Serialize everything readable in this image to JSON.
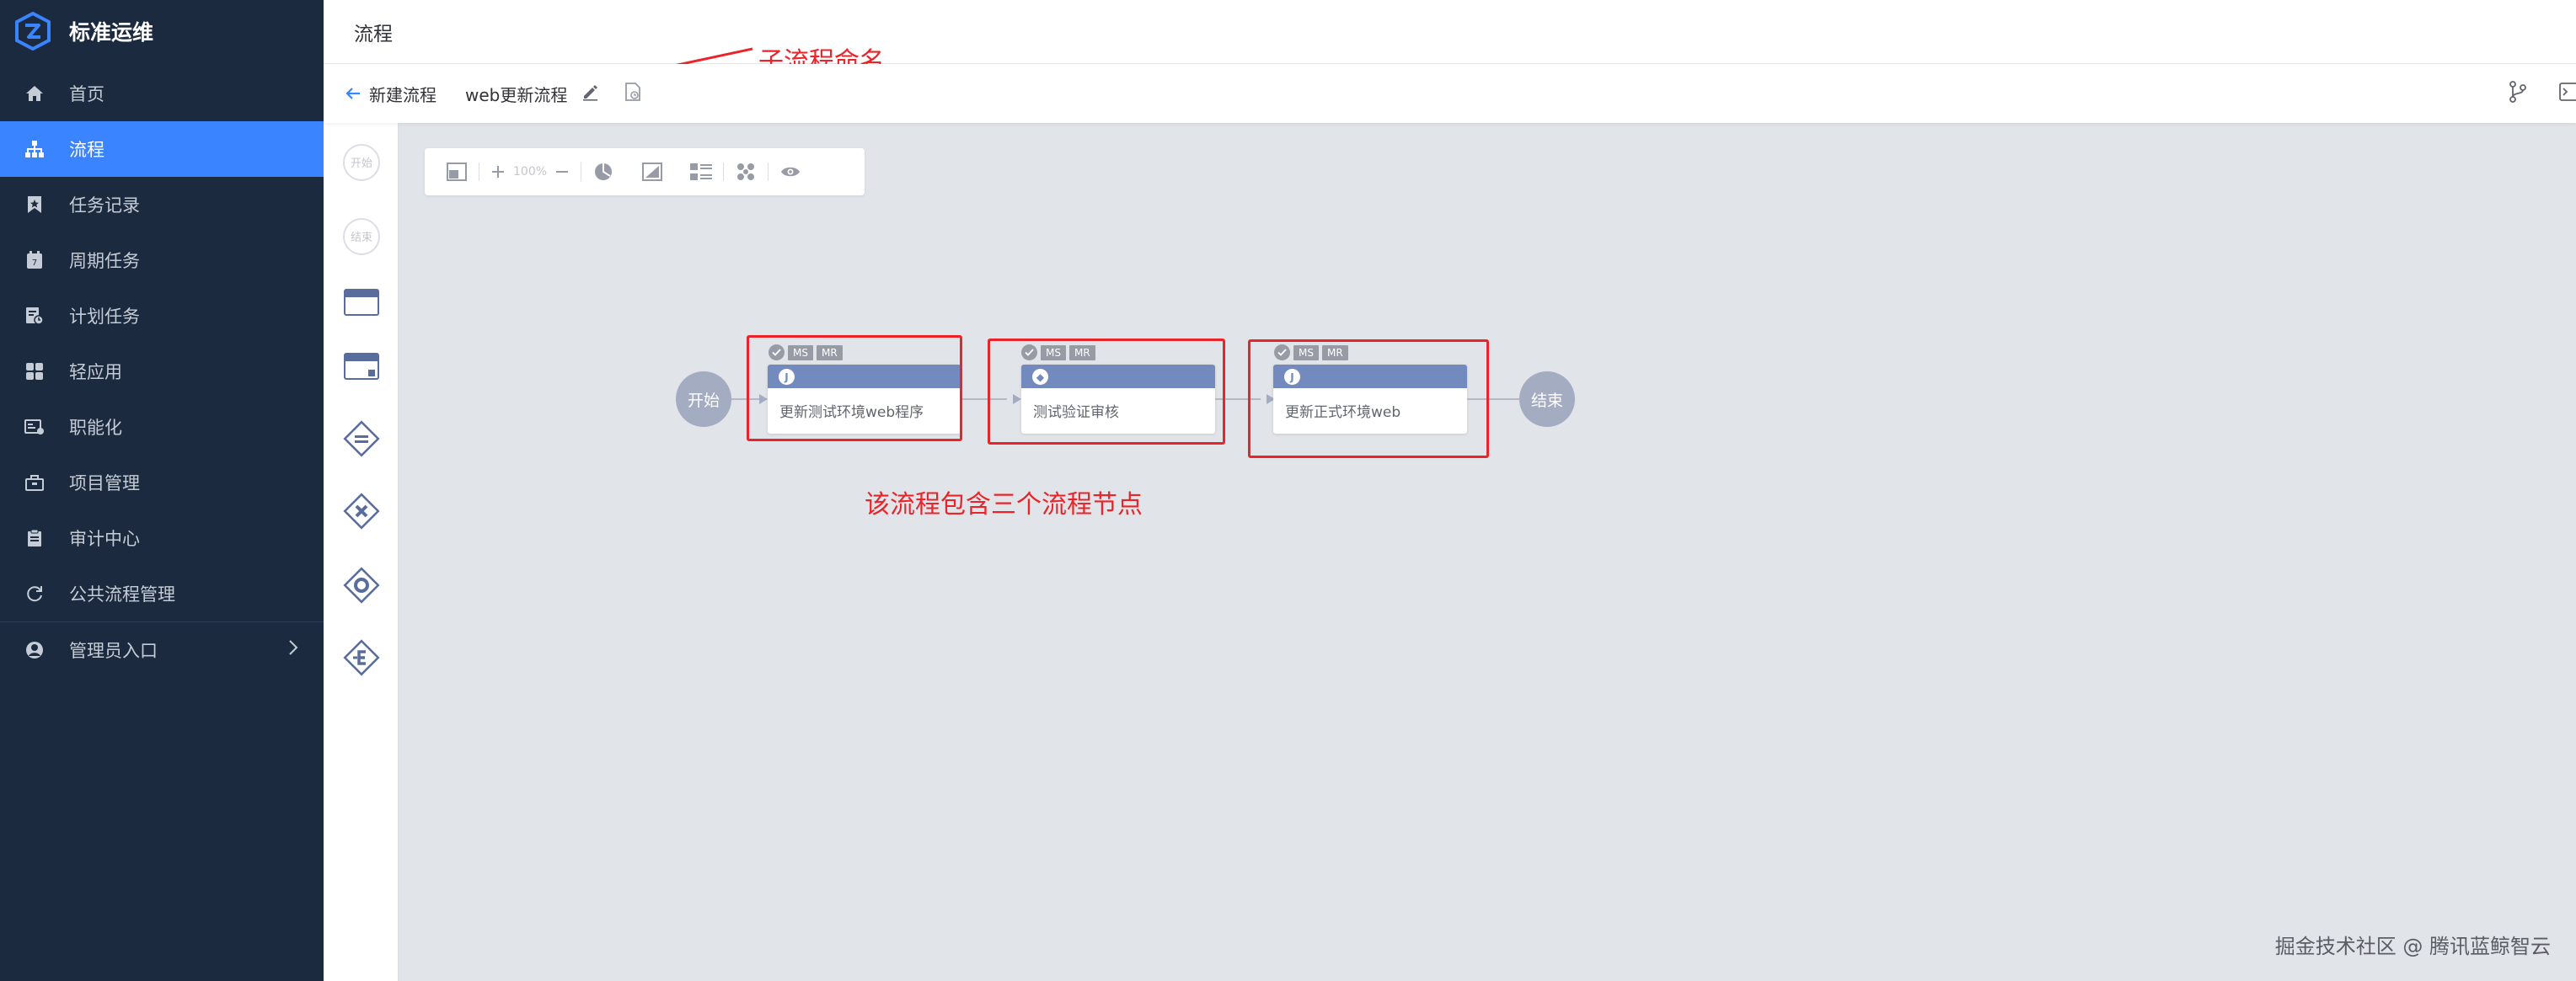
{
  "app": {
    "name": "标准运维"
  },
  "sidebar": {
    "items": [
      {
        "label": "首页",
        "icon": "home-icon"
      },
      {
        "label": "流程",
        "icon": "sitemap-icon",
        "active": true
      },
      {
        "label": "任务记录",
        "icon": "bookmark-icon"
      },
      {
        "label": "周期任务",
        "icon": "calendar-icon"
      },
      {
        "label": "计划任务",
        "icon": "schedule-icon"
      },
      {
        "label": "轻应用",
        "icon": "apps-icon"
      },
      {
        "label": "职能化",
        "icon": "function-icon"
      },
      {
        "label": "项目管理",
        "icon": "project-icon"
      },
      {
        "label": "审计中心",
        "icon": "clipboard-icon"
      },
      {
        "label": "公共流程管理",
        "icon": "refresh-icon"
      },
      {
        "label": "管理员入口",
        "icon": "user-icon"
      }
    ]
  },
  "header": {
    "title": "流程"
  },
  "subheader": {
    "back_label": "新建流程",
    "flow_name": "web更新流程"
  },
  "palette": {
    "start_label": "开始",
    "end_label": "结束"
  },
  "toolbar": {
    "zoom": "100%"
  },
  "flow": {
    "start_label": "开始",
    "end_label": "结束",
    "nodes": [
      {
        "name": "更新测试环境web程序",
        "badge": "J",
        "tags": [
          "MS",
          "MR"
        ]
      },
      {
        "name": "测试验证审核",
        "badge": "◆",
        "tags": [
          "MS",
          "MR"
        ]
      },
      {
        "name": "更新正式环境web",
        "badge": "J",
        "tags": [
          "MS",
          "MR"
        ]
      }
    ]
  },
  "annotations": {
    "rename": "子流程命名",
    "contains": "该流程包含三个流程节点"
  },
  "watermark": "掘金技术社区 @ 腾讯蓝鲸智云",
  "colors": {
    "sidebar_bg": "#1b2a3e",
    "active": "#3a84ff",
    "node_head": "#738abe",
    "annotation_red": "#e9242a",
    "canvas_bg": "#e1e4e8"
  }
}
